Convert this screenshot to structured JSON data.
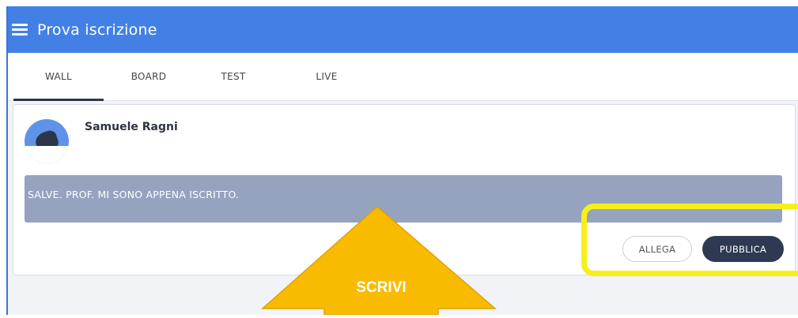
{
  "app": {
    "title": "Prova iscrizione",
    "accent_color": "#4380e6"
  },
  "tabs": [
    {
      "label": "WALL",
      "active": true
    },
    {
      "label": "BOARD",
      "active": false
    },
    {
      "label": "TEST",
      "active": false
    },
    {
      "label": "LIVE",
      "active": false
    }
  ],
  "post": {
    "author": "Samuele Ragni",
    "text": "SALVE. PROF. MI SONO APPENA ISCRITTO.",
    "attach_label": "ALLEGA",
    "publish_label": "PUBBLICA"
  },
  "annotations": {
    "arrow_label": "SCRIVI",
    "arrow_color": "#f9bb00",
    "highlight_color": "#f7ef1a"
  }
}
